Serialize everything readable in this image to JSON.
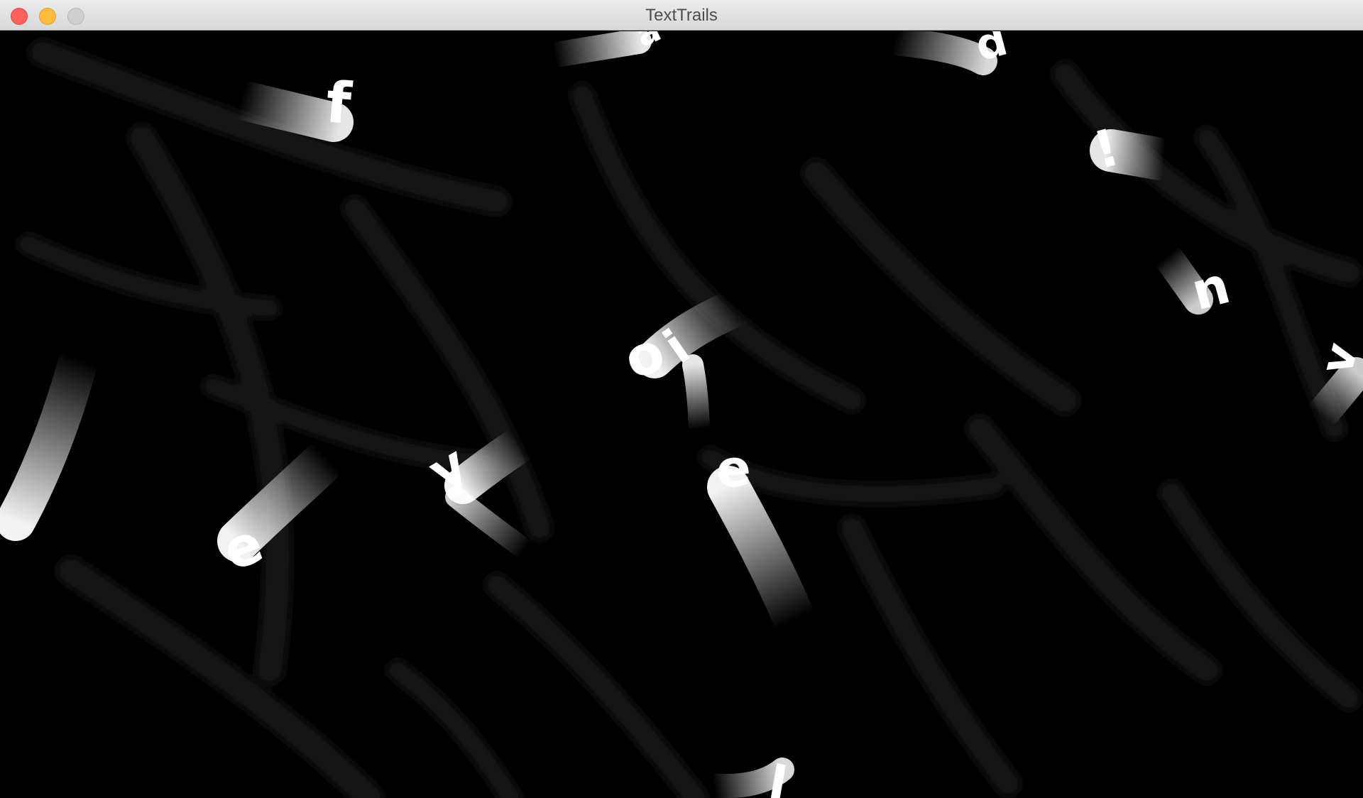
{
  "window": {
    "title": "TextTrails",
    "controls": {
      "close": "close-button",
      "minimize": "minimize-button",
      "zoom": "zoom-button"
    },
    "colors": {
      "close": "#fc615d",
      "minimize": "#fdbc40",
      "zoom": "#cfcfcf"
    }
  },
  "canvas": {
    "background": "#000000",
    "letter_color": "#ffffff",
    "letters": [
      "a",
      "f",
      "p",
      "!",
      "n",
      "o",
      "i",
      "v",
      "y",
      "e",
      "e",
      "l"
    ]
  }
}
